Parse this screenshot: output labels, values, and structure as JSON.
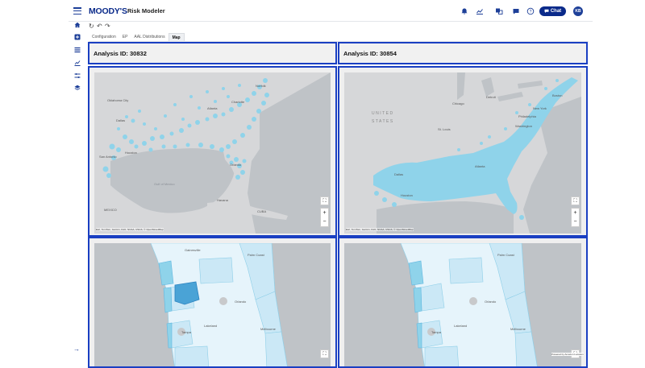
{
  "app": {
    "brand": "MOODY'S",
    "name": "Risk Modeler"
  },
  "header_icons": [
    "bell-icon",
    "chart-icon",
    "translate-icon",
    "message-icon",
    "help-icon"
  ],
  "chat": {
    "label": "Chat"
  },
  "user": {
    "initials": "KB"
  },
  "rail_icons": [
    "home-icon",
    "add-icon",
    "list-icon",
    "analytics-icon",
    "settings-sliders-icon",
    "layers-icon"
  ],
  "toolbar": {
    "redo_glyph": "↻",
    "undo_glyph": "↶",
    "forward_glyph": "↷"
  },
  "tabs": [
    {
      "label": "Configuration"
    },
    {
      "label": "EP"
    },
    {
      "label": "AAL Distributions"
    },
    {
      "label": "Map",
      "active": true
    }
  ],
  "panels": {
    "left": {
      "title": "Analysis ID: 30832"
    },
    "right": {
      "title": "Analysis ID: 30854"
    }
  },
  "map_labels": {
    "tl": {
      "oklahoma_city": "Oklahoma City",
      "dallas": "Dallas",
      "houston": "Houston",
      "san_antonio": "San Antonio",
      "atlanta": "Atlanta",
      "charlotte": "Charlotte",
      "norfolk": "Norfolk",
      "orlando": "Orlando",
      "havana": "Havana",
      "gulf": "Gulf of Mexico",
      "cuba": "CUBA",
      "mexico": "MEXICO"
    },
    "tr": {
      "united": "UNITED",
      "states": "STATES",
      "chicago": "Chicago",
      "st_louis": "St. Louis",
      "dallas": "Dallas",
      "houston": "Houston",
      "atlanta": "Atlanta",
      "new_york": "New York",
      "boston": "Boston",
      "philadelphia": "Philadelphia",
      "washington": "Washington",
      "detroit": "Detroit"
    },
    "bl": {
      "gainesville": "Gainesville",
      "palm_coast": "Palm Coast",
      "orlando": "Orlando",
      "lakeland": "Lakeland",
      "tampa": "Tampa",
      "melbourne": "Melbourne"
    },
    "br": {
      "palm_coast": "Palm Coast",
      "orlando": "Orlando",
      "lakeland": "Lakeland",
      "tampa": "Tampa",
      "melbourne": "Melbourne"
    }
  },
  "attribution": "Esri, TomTom, Garmin, FAO, NOAA, USGS, © OpenStreetMap",
  "powered_by": "Powered by Amazon Location",
  "colors": {
    "accent": "#1a3fc2",
    "brand": "#0a2a8a",
    "exposure": "#8fd3ea",
    "exposure_dark": "#4aa3d6",
    "land": "#d6d7d9",
    "water": "#bfc3c7"
  }
}
